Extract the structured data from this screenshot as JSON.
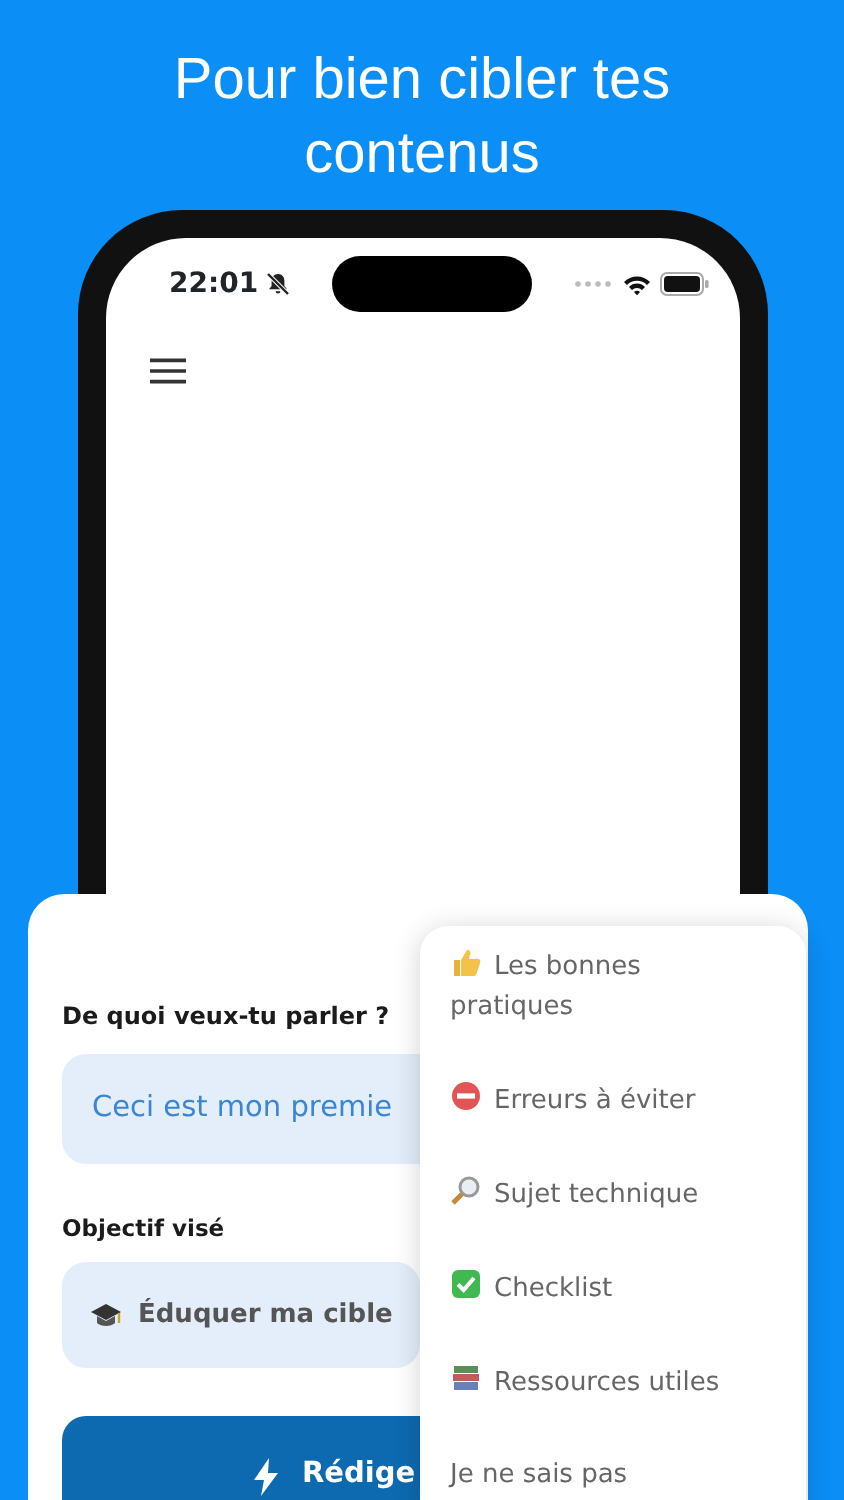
{
  "headline": "Pour bien cibler tes contenus",
  "status_bar": {
    "time": "22:01",
    "silent": true
  },
  "form": {
    "topic_label": "De quoi veux-tu parler ?",
    "topic_value": "Ceci est mon premie",
    "goal_label": "Objectif visé",
    "goal_value": "Éduquer ma cible",
    "submit": "Rédige"
  },
  "menu": [
    {
      "label": "Les bonnes pratiques"
    },
    {
      "label": "Erreurs à éviter"
    },
    {
      "label": "Sujet technique"
    },
    {
      "label": "Checklist"
    },
    {
      "label": "Ressources utiles"
    },
    {
      "label": "Je ne sais pas"
    }
  ]
}
